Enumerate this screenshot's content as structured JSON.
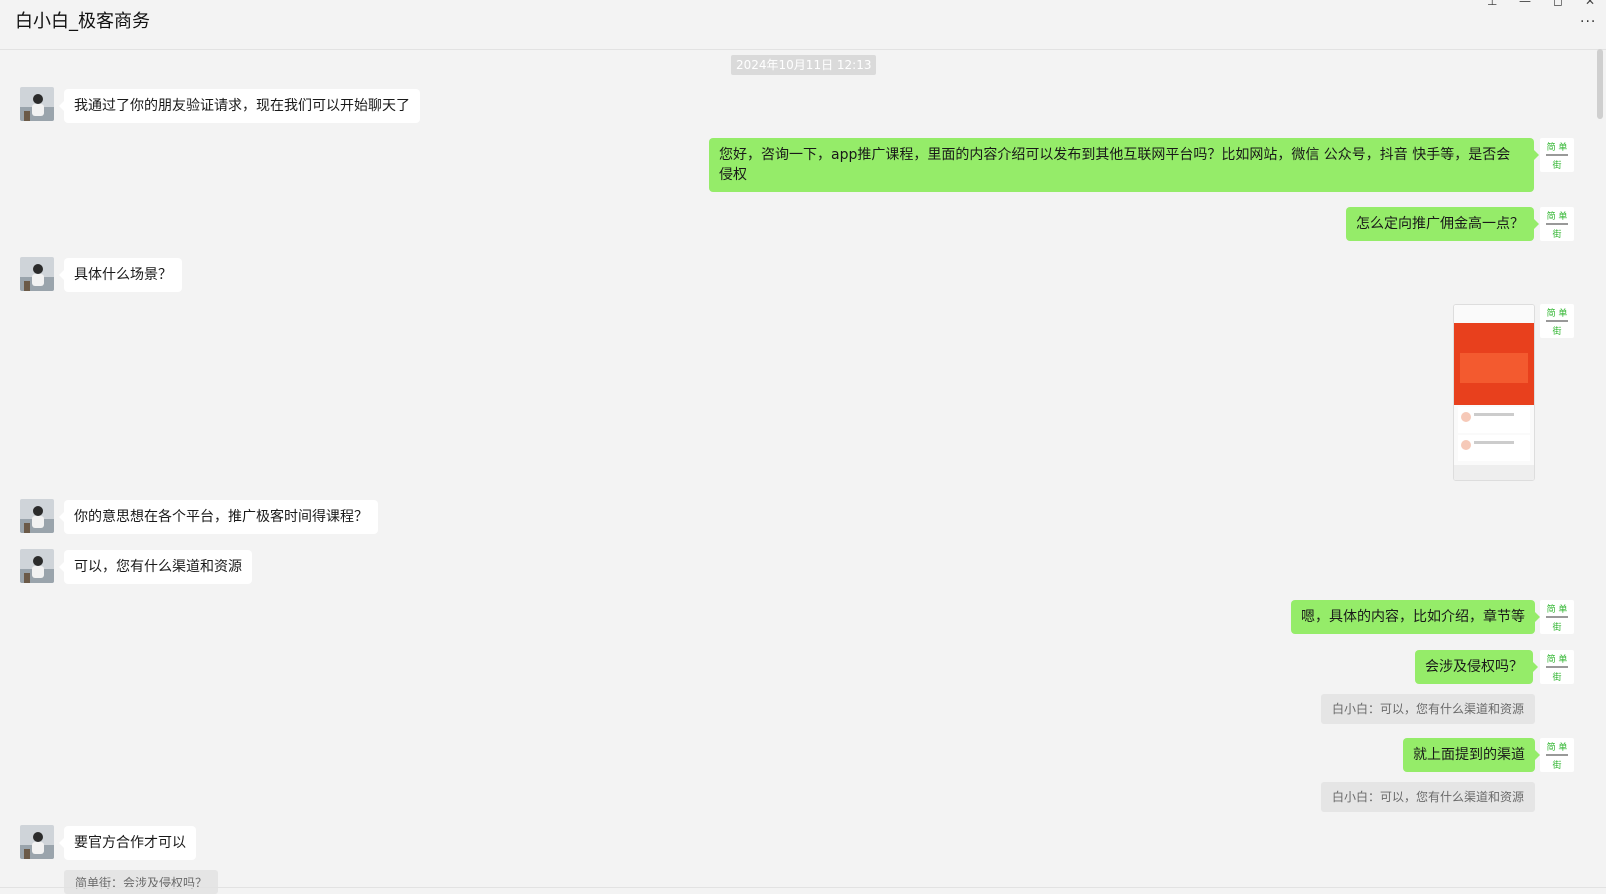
{
  "window": {
    "title": "白小白_极客商务",
    "more_label": "···",
    "controls": {
      "pin": "⊥",
      "minimize": "—",
      "maximize": "◻",
      "close": "✕"
    }
  },
  "chat": {
    "timestamp": "2024年10月11日 12:13",
    "messages": [
      {
        "side": "left",
        "text": "我通过了你的朋友验证请求，现在我们可以开始聊天了"
      },
      {
        "side": "right",
        "text": "您好，咨询一下，app推广课程，里面的内容介绍可以发布到其他互联网平台吗？比如网站，微信 公众号，抖音 快手等，是否会侵权"
      },
      {
        "side": "right",
        "text": "怎么定向推广佣金高一点？"
      },
      {
        "side": "left",
        "text": "具体什么场景？"
      },
      {
        "side": "right",
        "type": "image"
      },
      {
        "side": "left",
        "text": "你的意思想在各个平台，推广极客时间得课程？"
      },
      {
        "side": "left",
        "text": "可以，您有什么渠道和资源"
      },
      {
        "side": "right",
        "text": "嗯，具体的内容，比如介绍，章节等"
      },
      {
        "side": "right",
        "text": "会涉及侵权吗？",
        "quote": "白小白：可以，您有什么渠道和资源"
      },
      {
        "side": "right",
        "text": "就上面提到的渠道",
        "quote": "白小白：可以，您有什么渠道和资源"
      },
      {
        "side": "left",
        "text": "要官方合作才可以",
        "quote": "简单街：会涉及侵权吗？"
      }
    ],
    "self_avatar_text": "简单街"
  }
}
